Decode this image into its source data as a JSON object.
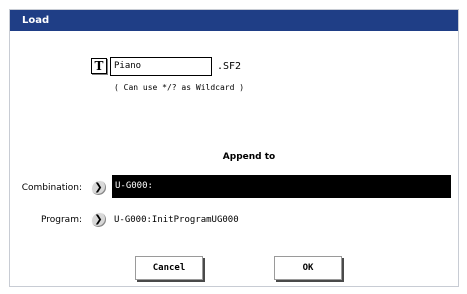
{
  "dialog": {
    "title": "Load"
  },
  "filename": {
    "type_icon": "T",
    "value": "Piano",
    "extension": ".SF2",
    "hint": "( Can use */? as Wildcard )"
  },
  "append": {
    "heading": "Append to",
    "combination": {
      "label": "Combination:",
      "value": "U-G000:"
    },
    "program": {
      "label": "Program:",
      "value": "U-G000:InitProgramUG000"
    },
    "arrow_glyph": "❯"
  },
  "buttons": {
    "cancel": "Cancel",
    "ok": "OK"
  },
  "colors": {
    "titlebar": "#1f3e86",
    "selected_field": "#000000"
  }
}
